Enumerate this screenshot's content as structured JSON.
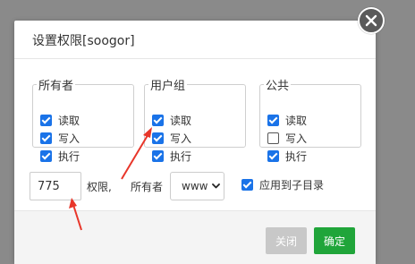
{
  "dialog": {
    "title": "设置权限[soogor]"
  },
  "groups": [
    {
      "legend": "所有者",
      "items": [
        {
          "label": "读取",
          "checked": true
        },
        {
          "label": "写入",
          "checked": true
        },
        {
          "label": "执行",
          "checked": true
        }
      ]
    },
    {
      "legend": "用户组",
      "items": [
        {
          "label": "读取",
          "checked": true
        },
        {
          "label": "写入",
          "checked": true
        },
        {
          "label": "执行",
          "checked": true
        }
      ]
    },
    {
      "legend": "公共",
      "items": [
        {
          "label": "读取",
          "checked": true
        },
        {
          "label": "写入",
          "checked": false
        },
        {
          "label": "执行",
          "checked": true
        }
      ]
    }
  ],
  "permission": {
    "value": "775",
    "suffix_label": "权限,",
    "owner_label": "所有者",
    "owner_value": "www"
  },
  "apply_sub": {
    "label": "应用到子目录",
    "checked": true
  },
  "buttons": {
    "close": "关闭",
    "confirm": "确定"
  },
  "colors": {
    "accent_checkbox": "#1a73e8",
    "confirm_button": "#20a53a",
    "annotation_arrow": "#e8362a"
  }
}
